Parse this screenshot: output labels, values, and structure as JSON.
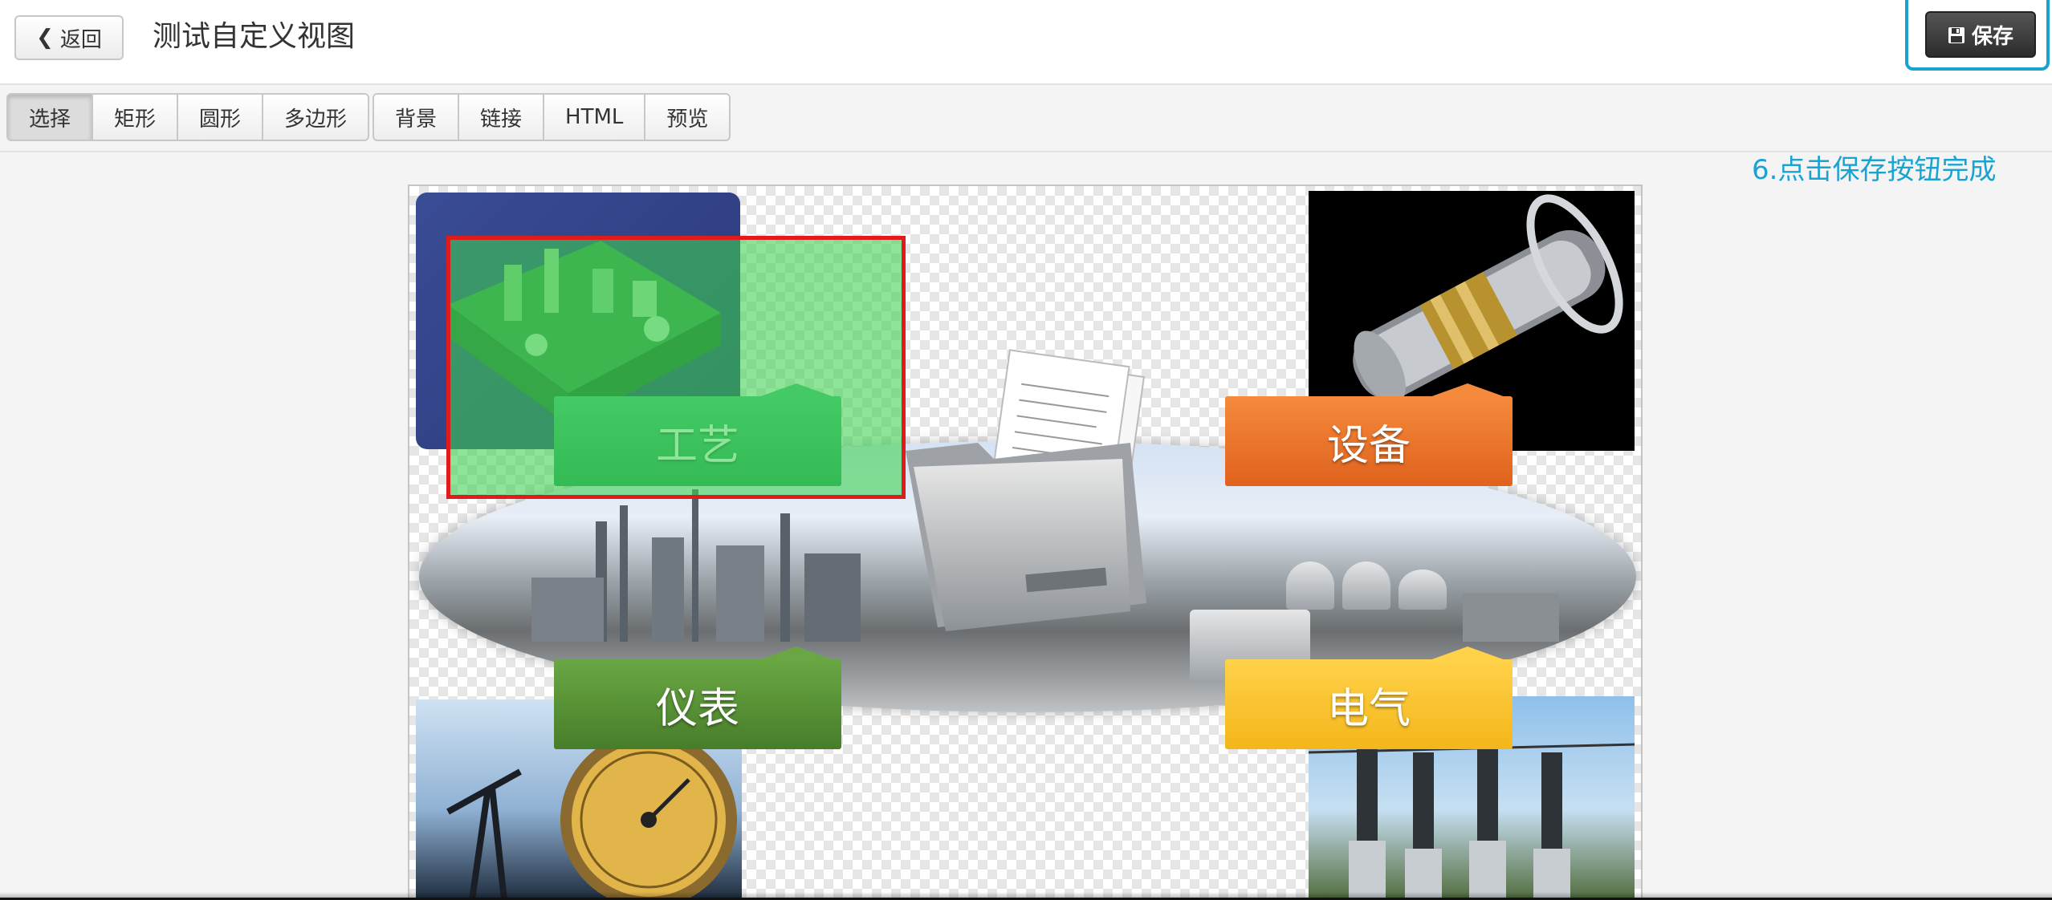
{
  "header": {
    "back_label": "返回",
    "title": "测试自定义视图",
    "save_label": "保存"
  },
  "callout": {
    "text": "6.点击保存按钮完成",
    "color": "#1aa3d1"
  },
  "toolbar": {
    "shape_tools": [
      {
        "label": "选择",
        "active": true
      },
      {
        "label": "矩形",
        "active": false
      },
      {
        "label": "圆形",
        "active": false
      },
      {
        "label": "多边形",
        "active": false
      }
    ],
    "extra_tools": [
      {
        "label": "背景"
      },
      {
        "label": "链接"
      },
      {
        "label": "HTML"
      },
      {
        "label": "预览"
      }
    ]
  },
  "canvas": {
    "labels": {
      "process": "工艺",
      "equipment": "设备",
      "instrument": "仪表",
      "electric": "电气"
    },
    "selection_color": "#e01b1b"
  },
  "icons": {
    "back": "chevron-left-icon",
    "save": "floppy-disk-icon"
  }
}
